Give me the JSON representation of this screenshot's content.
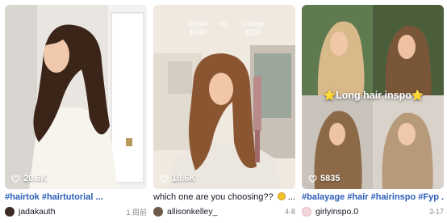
{
  "videos": [
    {
      "likes": "20.6K",
      "caption_tags": "#hairtok #hairtutorial ...",
      "caption_text": "",
      "username": "jadakauth",
      "date": "1 周前"
    },
    {
      "likes": "18.6K",
      "caption_tags": "",
      "caption_text": "which one are you choosing?? ",
      "caption_suffix": " ...",
      "username": "allisonkelley_",
      "date": "4-8",
      "overlay": {
        "left_brand": "Dyson",
        "left_price": "$650",
        "vs": "vs.",
        "right_brand": "L'ange",
        "right_price": "$290"
      }
    },
    {
      "likes": "5835",
      "caption_tags": "#balayage #hair #hairinspo #Fyp ...",
      "caption_text": "",
      "username": "girlyinspo.0",
      "date": "3-17",
      "overlay": {
        "title": "⭐Long hair inspo⭐"
      }
    }
  ],
  "icons": {
    "likes": "heart-outline-icon",
    "emoji": "grimacing-emoji-icon"
  },
  "colors": {
    "hashtag": "#2b5db8",
    "text": "#161823",
    "muted": "#8a8b91"
  }
}
